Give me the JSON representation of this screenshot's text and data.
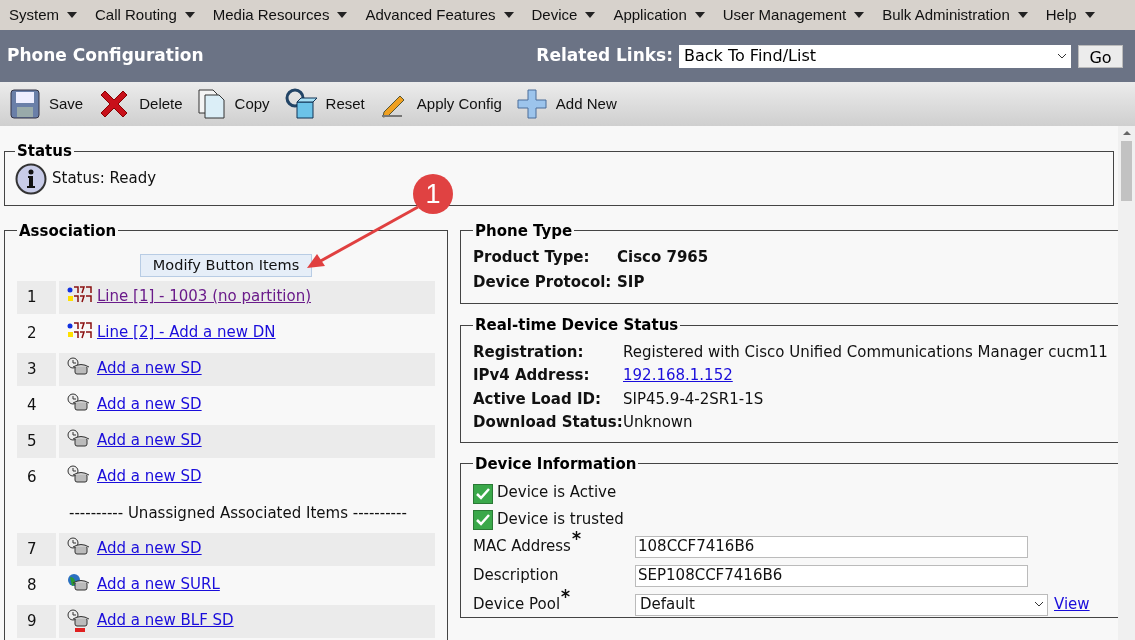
{
  "menu": [
    {
      "label": "System"
    },
    {
      "label": "Call Routing"
    },
    {
      "label": "Media Resources"
    },
    {
      "label": "Advanced Features"
    },
    {
      "label": "Device"
    },
    {
      "label": "Application"
    },
    {
      "label": "User Management"
    },
    {
      "label": "Bulk Administration"
    },
    {
      "label": "Help"
    }
  ],
  "header": {
    "title": "Phone Configuration",
    "related_links_label": "Related Links:",
    "related_links_value": "Back To Find/List",
    "go_button": "Go"
  },
  "toolbar": [
    {
      "kind": "save",
      "label": "Save"
    },
    {
      "kind": "delete",
      "label": "Delete"
    },
    {
      "kind": "copy",
      "label": "Copy"
    },
    {
      "kind": "reset",
      "label": "Reset"
    },
    {
      "kind": "apply",
      "label": "Apply Config"
    },
    {
      "kind": "add",
      "label": "Add New"
    }
  ],
  "status": {
    "legend": "Status",
    "text": "Status: Ready"
  },
  "association": {
    "legend": "Association",
    "modify_button": "Modify Button Items",
    "items": [
      {
        "kind": "line",
        "number": "1",
        "label": "Line [1] - 1003 (no partition)",
        "visited": true
      },
      {
        "kind": "line",
        "number": "2",
        "label": "Line [2] - Add a new DN",
        "visited": false
      },
      {
        "kind": "sd",
        "number": "3",
        "label": "Add a new SD",
        "visited": false
      },
      {
        "kind": "sd",
        "number": "4",
        "label": "Add a new SD",
        "visited": false
      },
      {
        "kind": "sd",
        "number": "5",
        "label": "Add a new SD",
        "visited": false
      },
      {
        "kind": "sd",
        "number": "6",
        "label": "Add a new SD",
        "visited": false
      },
      {
        "kind": "separator",
        "label": "---------- Unassigned Associated Items ----------"
      },
      {
        "kind": "sd",
        "number": "7",
        "label": "Add a new SD",
        "visited": false
      },
      {
        "kind": "surl",
        "number": "8",
        "label": "Add a new SURL",
        "visited": false
      },
      {
        "kind": "blf",
        "number": "9",
        "label": "Add a new BLF SD",
        "visited": false
      }
    ]
  },
  "phone_type": {
    "legend": "Phone Type",
    "fields": [
      {
        "label": "Product Type:",
        "value": "Cisco 7965"
      },
      {
        "label": "Device Protocol:",
        "value": "SIP"
      }
    ]
  },
  "realtime": {
    "legend": "Real-time Device Status",
    "fields": [
      {
        "kind": "text",
        "label": "Registration:",
        "value": "Registered with Cisco Unified Communications Manager cucm11"
      },
      {
        "kind": "link",
        "label": "IPv4 Address:",
        "value": "192.168.1.152"
      },
      {
        "kind": "text",
        "label": "Active Load ID:",
        "value": "SIP45.9-4-2SR1-1S"
      },
      {
        "kind": "text",
        "label": "Download Status:",
        "value": "Unknown"
      }
    ]
  },
  "device_info": {
    "legend": "Device Information",
    "checkboxes": [
      {
        "label": "Device is Active",
        "checked": true
      },
      {
        "label": "Device is trusted",
        "checked": true
      }
    ],
    "fields": [
      {
        "kind": "text",
        "label": "MAC Address",
        "required": true,
        "value": "108CCF7416B6"
      },
      {
        "kind": "text",
        "label": "Description",
        "required": false,
        "value": "SEP108CCF7416B6"
      },
      {
        "kind": "select",
        "label": "Device Pool",
        "required": true,
        "value": "Default",
        "link": "View"
      }
    ]
  },
  "annotation": {
    "number": "1"
  }
}
